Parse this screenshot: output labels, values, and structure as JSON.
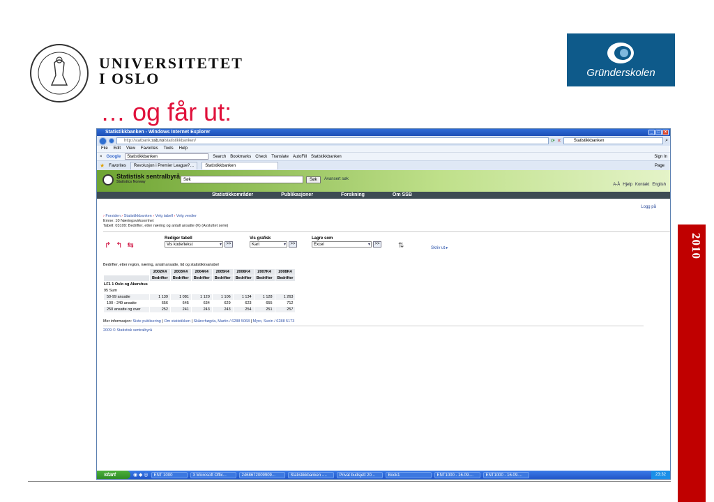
{
  "slide": {
    "university_line1": "UNIVERSITETET",
    "university_line2": "I OSLO",
    "logo_text": "Gründerskolen",
    "title": "… og får ut:",
    "year": "2010"
  },
  "browser": {
    "window_title": "Statistikkbanken - Windows Internet Explorer",
    "url_prefix": "http://statbank.",
    "url_domain": "ssb.no",
    "url_suffix": "/statistikkbanken/",
    "search_box": "Statistikkbanken",
    "menu": [
      "File",
      "Edit",
      "View",
      "Favorites",
      "Tools",
      "Help"
    ],
    "google_label": "Google",
    "google_query": "Statistikkbanken",
    "google_buttons": [
      "Search",
      "Bookmarks",
      "Check",
      "Translate",
      "AutoFill",
      "Statistikkbanken"
    ],
    "sign_in": "Sign In",
    "favorites_label": "Favorites",
    "tabs": [
      "Revolusjon i Premier League?…",
      "Statistikkbanken"
    ],
    "page_label": "Page"
  },
  "site": {
    "name": "Statistisk sentralbyrå",
    "subtitle": "Statistics Norway",
    "search_value": "Søk",
    "search_button": "Søk",
    "advanced_search": "Avansert søk",
    "top_links": [
      "A-Å",
      "Hjelp",
      "Kontakt",
      "English"
    ],
    "nav": [
      "Statistikkområder",
      "Publikasjoner",
      "Forskning",
      "Om SSB"
    ],
    "logout": "Logg på",
    "breadcrumb": {
      "prefix": "›",
      "items": [
        "Forsiden",
        "Statistikkbanken",
        "Velg tabell",
        "Velg verdier"
      ]
    },
    "subject": "Emne: 10 Næringsvirksomhet",
    "table_ref": "Tabell: 03109: Bedrifter, etter næring og antall ansatte (K) (Avsluttet serie)",
    "tools": {
      "edit_label": "Rediger tabell",
      "edit_value": "Vis kode/tekst",
      "chart_label": "Vis grafisk",
      "chart_value": "Kart",
      "save_label": "Lagre som",
      "save_value": "Excel",
      "go": ">>",
      "print": "Skriv ut"
    },
    "table": {
      "caption": "Bedrifter, etter region, næring, antall ansatte, tid og statistikkvariabel",
      "periods": [
        "2002K4",
        "2003K4",
        "2004K4",
        "2005K4",
        "2006K4",
        "2007K4",
        "2008K4"
      ],
      "variable": "Bedrifter",
      "region": "LF1 1 Oslo og Akershus",
      "industry": "95 Sum",
      "rows": [
        {
          "label": "50-99 ansatte",
          "values": [
            "1 139",
            "1 081",
            "1 120",
            "1 106",
            "1 134",
            "1 128",
            "1 263"
          ]
        },
        {
          "label": "100 - 249 ansatte",
          "values": [
            "656",
            "645",
            "634",
            "629",
            "623",
            "655",
            "712"
          ]
        },
        {
          "label": "250 ansatte og over",
          "values": [
            "252",
            "241",
            "243",
            "243",
            "254",
            "251",
            "257"
          ]
        }
      ]
    },
    "more_info": {
      "label": "Mer informasjon:",
      "links": [
        "Siste publisering",
        "Om statistikken",
        "Skårerhøgda, Martin / 6288 5068",
        "Myro, Svein / 6288 5173"
      ]
    },
    "copyright": "2009 © Statistisk sentralbyrå"
  },
  "taskbar": {
    "start": "start",
    "tasks": [
      "ENT 1000",
      "3 Microsoft Offic...",
      "2468672009909...",
      "Statistikkbanken -...",
      "Privat budsjett 20...",
      "Book1",
      "ENT1000 - 16.09....",
      "ENT1000 - 16.09...."
    ],
    "clock": "23:32"
  },
  "colors": {
    "title_red": "#e0103a",
    "side_bar": "#c00000",
    "logo_blue": "#0e5a8a",
    "ssb_green": "#6ea432"
  }
}
